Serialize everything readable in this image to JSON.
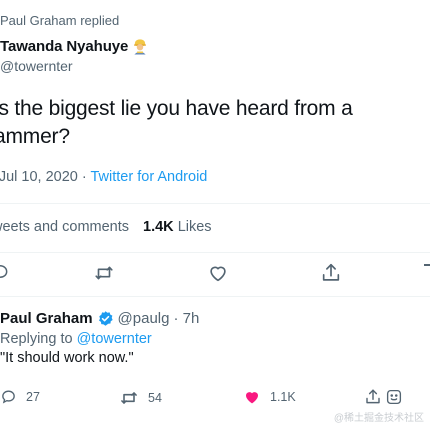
{
  "reply_notice": "Paul Graham replied",
  "tweet": {
    "author_name": "Tawanda Nyahuye",
    "author_handle": "@towernter",
    "text": "is the biggest lie you have heard from a\nammer?",
    "text_line1": "is the biggest lie you have heard from a",
    "text_line2": "ammer?",
    "meta_date": "· Jul 10, 2020 · ",
    "source": "Twitter for Android",
    "stats_retweets_label": "weets and comments",
    "likes_count": "1.4K",
    "likes_label": "Likes",
    "emoji_icon": "construction-worker-emoji"
  },
  "reply": {
    "name": "Paul Graham",
    "handle": "@paulg",
    "time": "· 7h",
    "replying_prefix": "Replying to",
    "replying_to": "@towernter",
    "text": "\"It should work now.\"",
    "reply_count": "27",
    "retweet_count": "54",
    "like_count": "1.1K"
  },
  "watermark": "@稀土掘金技术社区",
  "colors": {
    "link": "#1d9bf0",
    "muted": "#536471",
    "like_red": "#f91880",
    "verified": "#1d9bf0"
  }
}
